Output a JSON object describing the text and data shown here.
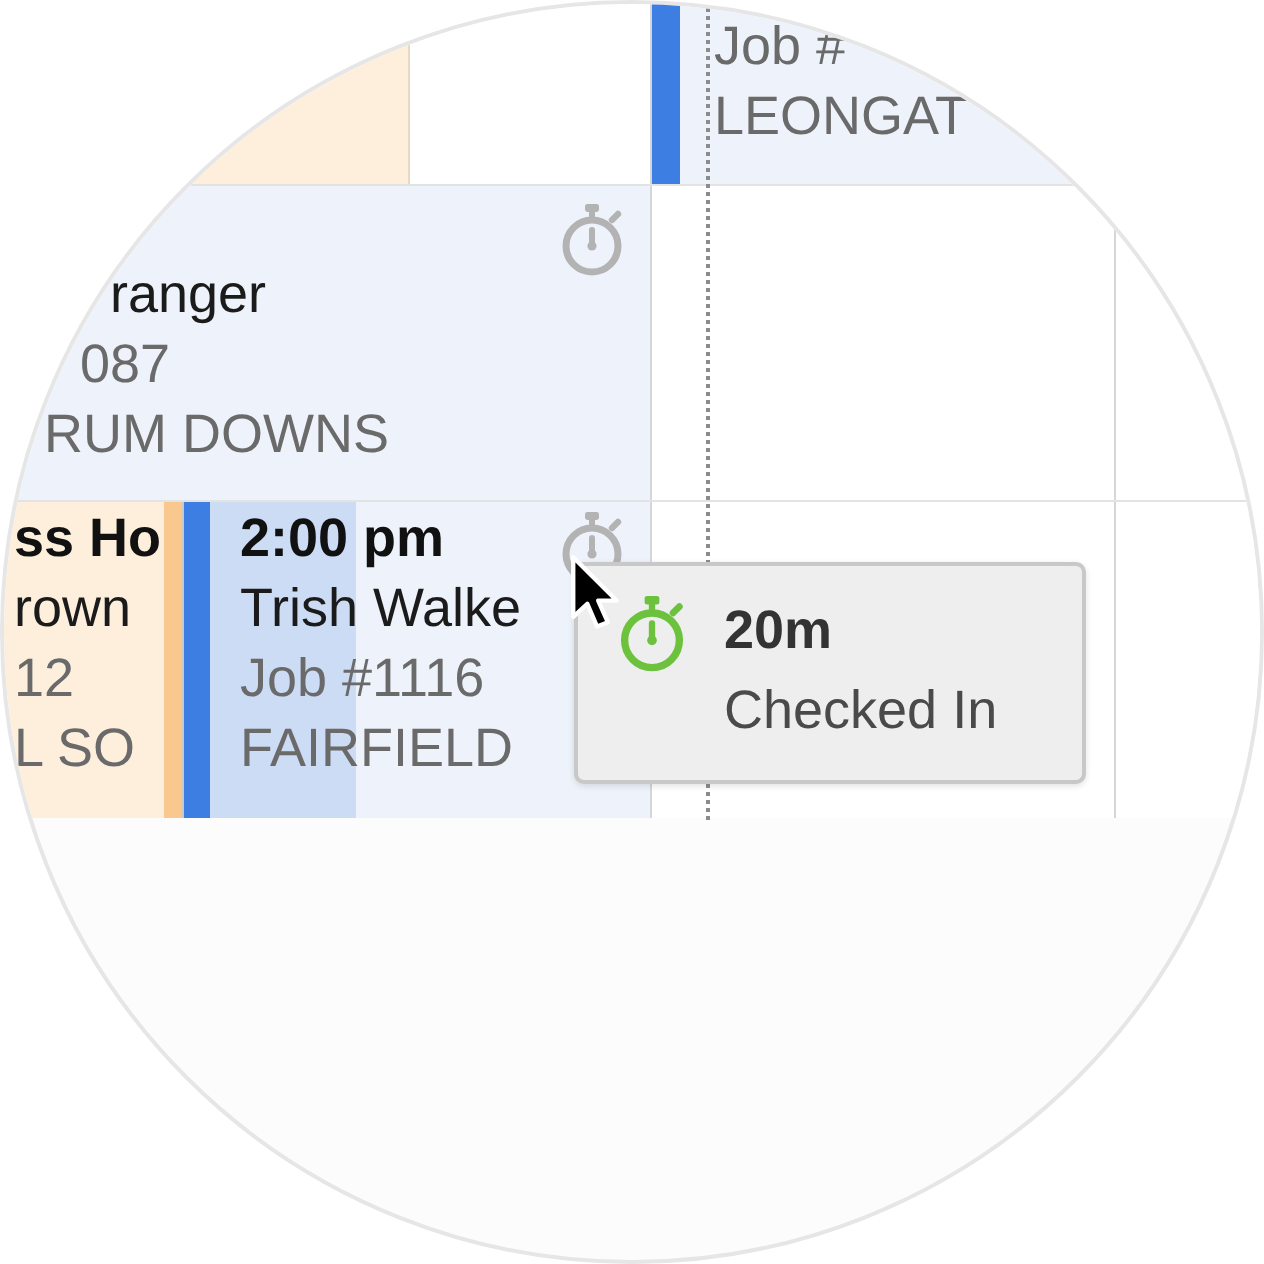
{
  "calendar": {
    "rows": [
      {
        "events": [
          {
            "color": "#fdefdc"
          },
          {
            "color": "#eef3fb",
            "bar": {
              "color": "#3d7ee3"
            },
            "lines": [
              {
                "kind": "job",
                "text": "Job #"
              },
              {
                "kind": "suburb",
                "text": "LEONGAT"
              }
            ]
          }
        ]
      },
      {
        "events": [
          {
            "color": "#eef3fb",
            "timer_icon": true,
            "lines": [
              {
                "kind": "name",
                "text": "ranger"
              },
              {
                "kind": "job",
                "text": "087"
              },
              {
                "kind": "suburb",
                "text": "RUM DOWNS"
              }
            ]
          }
        ]
      },
      {
        "events": [
          {
            "color": "#fdefdc",
            "bar": {
              "color": "#f9c88f"
            },
            "lines": [
              {
                "kind": "title",
                "text": "ss Ho"
              },
              {
                "kind": "name",
                "text": "rown"
              },
              {
                "kind": "job",
                "text": "12"
              },
              {
                "kind": "suburb",
                "text": "L SO"
              }
            ]
          },
          {
            "color": "#eef3fb",
            "bar": {
              "color": "#3d7ee3"
            },
            "level": 0.33,
            "timer_icon": true,
            "lines": [
              {
                "kind": "time",
                "text": "2:00 pm"
              },
              {
                "kind": "name",
                "text": "Trish Walke"
              },
              {
                "kind": "job",
                "text": "Job #1116"
              },
              {
                "kind": "suburb",
                "text": "FAIRFIELD"
              }
            ]
          }
        ]
      }
    ]
  },
  "tooltip": {
    "duration": "20m",
    "status": "Checked In"
  }
}
